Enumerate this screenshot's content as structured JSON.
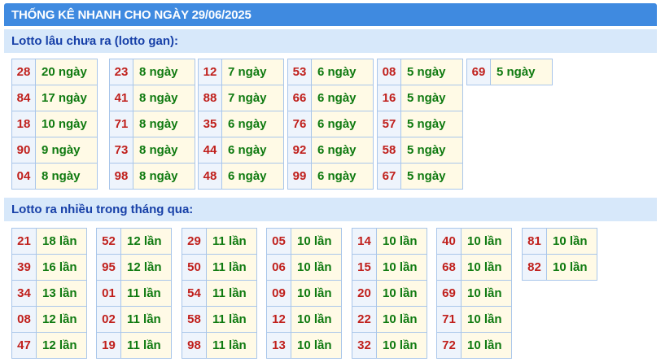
{
  "title": "THỐNG KÊ NHANH CHO NGÀY 29/06/2025",
  "gan": {
    "heading": "Lotto lâu chưa ra (lotto gan):",
    "groups": [
      [
        [
          "28",
          "20 ngày"
        ],
        [
          "84",
          "17 ngày"
        ],
        [
          "18",
          "10 ngày"
        ],
        [
          "90",
          "9 ngày"
        ],
        [
          "04",
          "8 ngày"
        ]
      ],
      [
        [
          "23",
          "8 ngày"
        ],
        [
          "41",
          "8 ngày"
        ],
        [
          "71",
          "8 ngày"
        ],
        [
          "73",
          "8 ngày"
        ],
        [
          "98",
          "8 ngày"
        ]
      ],
      [
        [
          "12",
          "7 ngày"
        ],
        [
          "88",
          "7 ngày"
        ],
        [
          "35",
          "6 ngày"
        ],
        [
          "44",
          "6 ngày"
        ],
        [
          "48",
          "6 ngày"
        ]
      ],
      [
        [
          "53",
          "6 ngày"
        ],
        [
          "66",
          "6 ngày"
        ],
        [
          "76",
          "6 ngày"
        ],
        [
          "92",
          "6 ngày"
        ],
        [
          "99",
          "6 ngày"
        ]
      ],
      [
        [
          "08",
          "5 ngày"
        ],
        [
          "16",
          "5 ngày"
        ],
        [
          "57",
          "5 ngày"
        ],
        [
          "58",
          "5 ngày"
        ],
        [
          "67",
          "5 ngày"
        ]
      ],
      [
        [
          "69",
          "5 ngày"
        ]
      ]
    ]
  },
  "nhieu": {
    "heading": "Lotto ra nhiều trong tháng qua:",
    "groups": [
      [
        [
          "21",
          "18 lần"
        ],
        [
          "39",
          "16 lần"
        ],
        [
          "34",
          "13 lần"
        ],
        [
          "08",
          "12 lần"
        ],
        [
          "47",
          "12 lần"
        ]
      ],
      [
        [
          "52",
          "12 lần"
        ],
        [
          "95",
          "12 lần"
        ],
        [
          "01",
          "11 lần"
        ],
        [
          "02",
          "11 lần"
        ],
        [
          "19",
          "11 lần"
        ]
      ],
      [
        [
          "29",
          "11 lần"
        ],
        [
          "50",
          "11 lần"
        ],
        [
          "54",
          "11 lần"
        ],
        [
          "58",
          "11 lần"
        ],
        [
          "98",
          "11 lần"
        ]
      ],
      [
        [
          "05",
          "10 lần"
        ],
        [
          "06",
          "10 lần"
        ],
        [
          "09",
          "10 lần"
        ],
        [
          "12",
          "10 lần"
        ],
        [
          "13",
          "10 lần"
        ]
      ],
      [
        [
          "14",
          "10 lần"
        ],
        [
          "15",
          "10 lần"
        ],
        [
          "20",
          "10 lần"
        ],
        [
          "22",
          "10 lần"
        ],
        [
          "32",
          "10 lần"
        ]
      ],
      [
        [
          "40",
          "10 lần"
        ],
        [
          "68",
          "10 lần"
        ],
        [
          "69",
          "10 lần"
        ],
        [
          "71",
          "10 lần"
        ],
        [
          "72",
          "10 lần"
        ]
      ],
      [
        [
          "81",
          "10 lần"
        ],
        [
          "82",
          "10 lần"
        ]
      ]
    ]
  }
}
